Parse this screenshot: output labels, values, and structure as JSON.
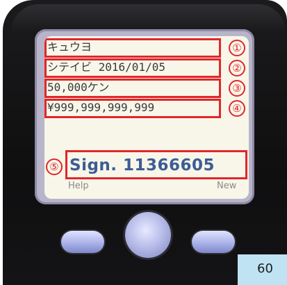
{
  "screen": {
    "lines": [
      {
        "text": "キュウヨ",
        "marker": "①"
      },
      {
        "text": "シテイビ 2016/01/05",
        "marker": "②"
      },
      {
        "text": "50,000ケン",
        "marker": "③"
      },
      {
        "text": "¥999,999,999,999",
        "marker": "④"
      }
    ],
    "sign": {
      "text": "Sign. 11366605",
      "marker": "⑤"
    },
    "softkeys": {
      "left": "Help",
      "right": "New"
    }
  },
  "overlay_tag": "60",
  "colors": {
    "highlight": "#e1262a",
    "sign_text": "#3d5c95",
    "screen_bg": "#f7f6e9",
    "button": "#aab2e8"
  }
}
